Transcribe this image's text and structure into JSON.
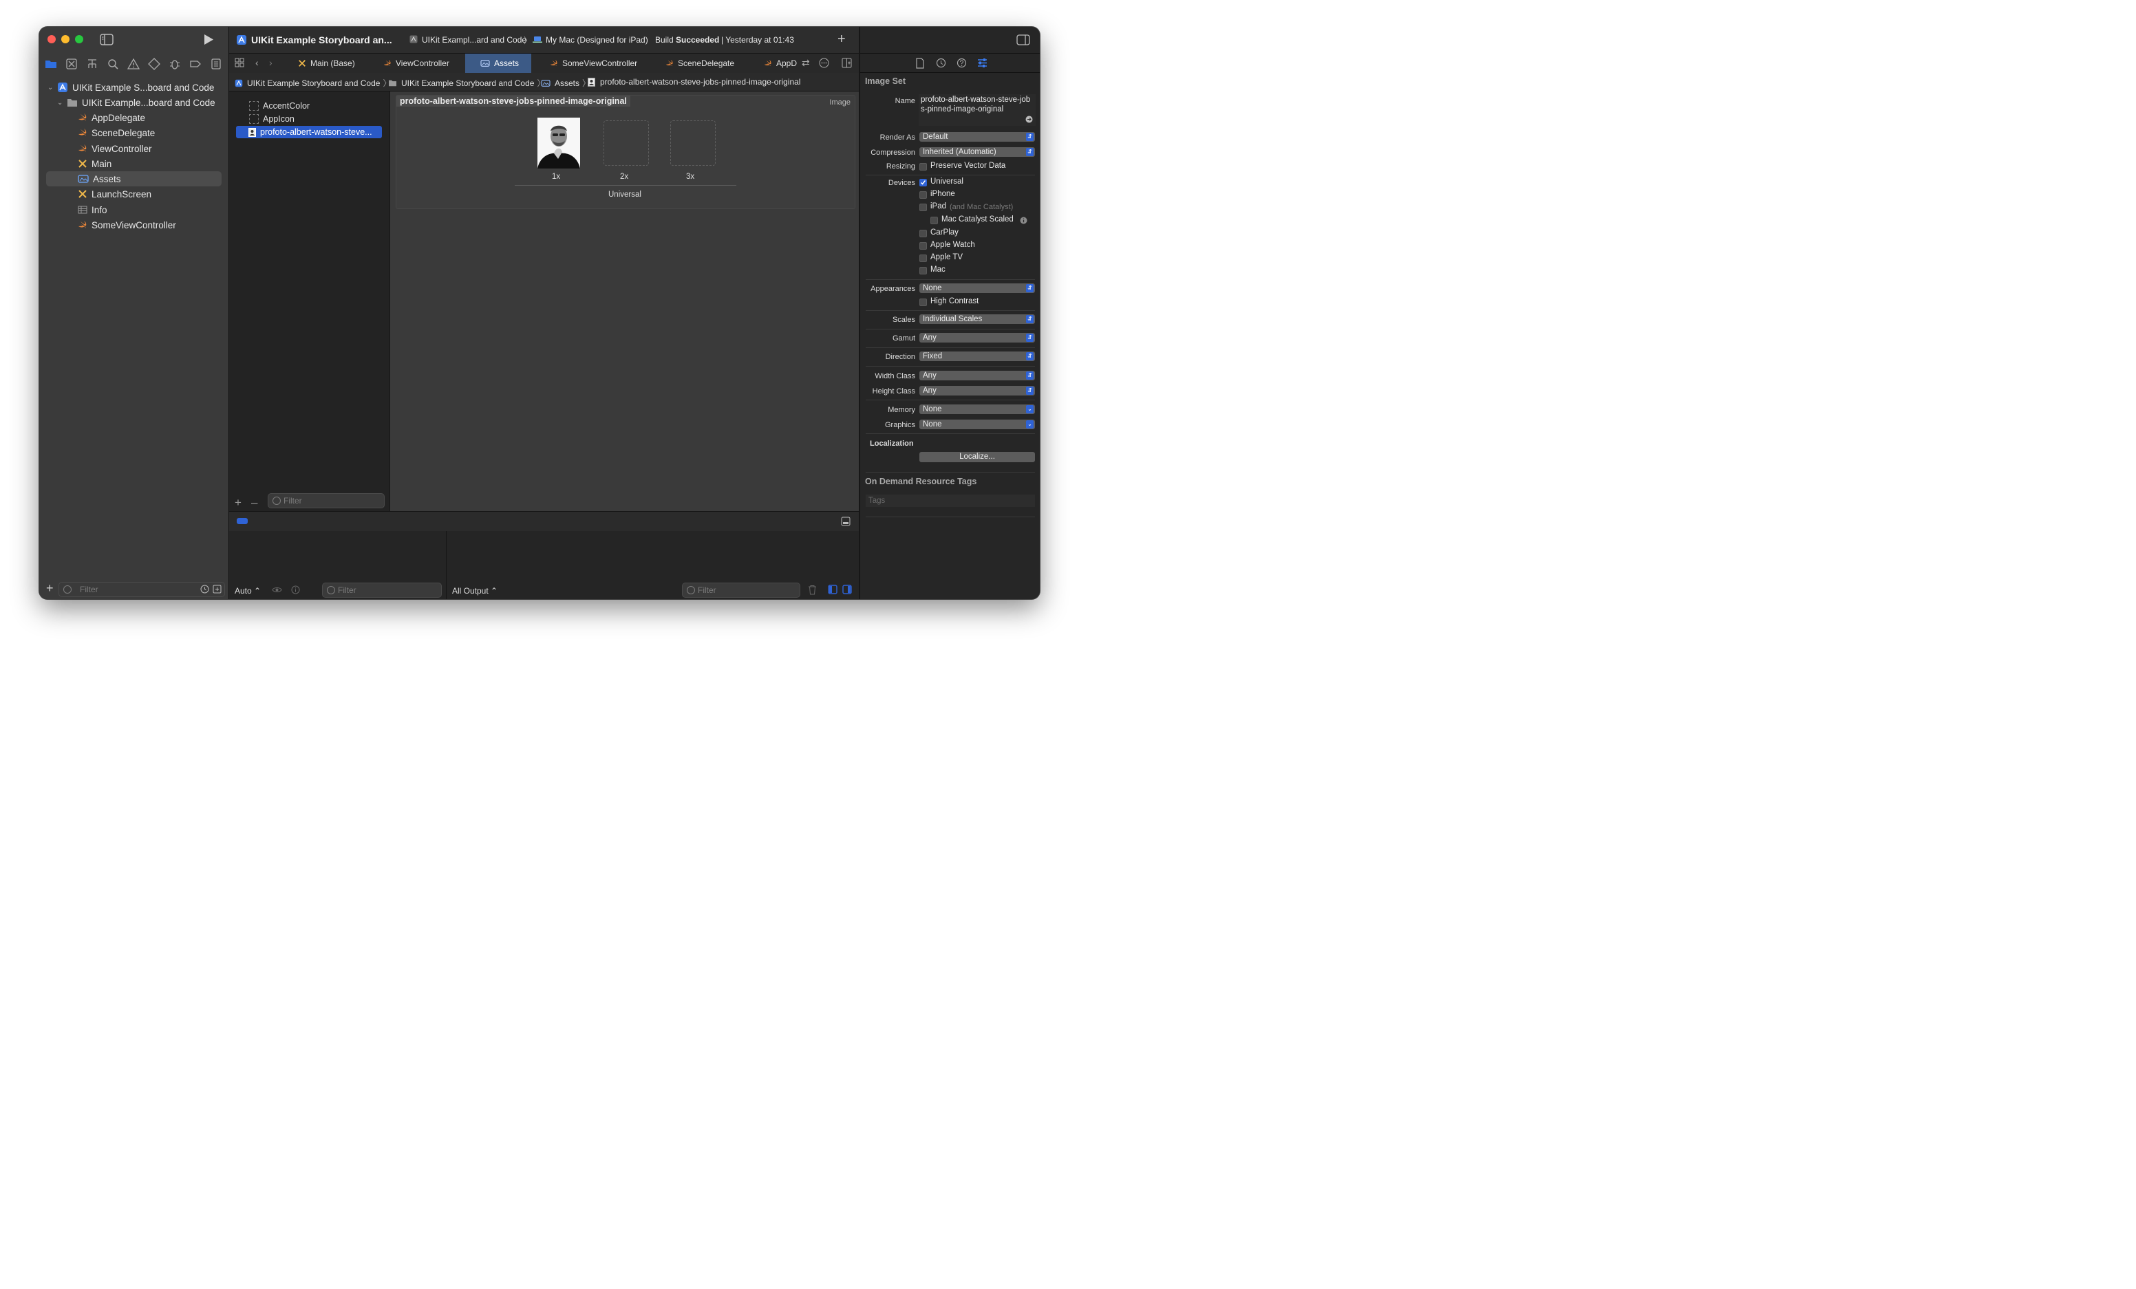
{
  "colors": {
    "accent": "#2f63d6",
    "swift_orange": "#f28a3a",
    "traffic_red": "#ff5f57",
    "traffic_yellow": "#febc2e",
    "traffic_green": "#28c840"
  },
  "titlebar": {
    "project_title": "UIKit Example Storyboard an...",
    "scheme": "UIKit Exampl...ard and Code",
    "destination": "My Mac (Designed for iPad)",
    "status_prefix": "Build",
    "status_bold": "Succeeded",
    "status_suffix": "| Yesterday at 01:43"
  },
  "navigator": {
    "tree": [
      {
        "label": "UIKit Example S...board and Code",
        "icon": "project-icon",
        "level": 0
      },
      {
        "label": "UIKit Example...board and Code",
        "icon": "folder-icon",
        "level": 1
      },
      {
        "label": "AppDelegate",
        "icon": "swift-file-icon",
        "level": 2
      },
      {
        "label": "SceneDelegate",
        "icon": "swift-file-icon",
        "level": 2
      },
      {
        "label": "ViewController",
        "icon": "swift-file-icon",
        "level": 2
      },
      {
        "label": "Main",
        "icon": "storyboard-icon",
        "level": 2
      },
      {
        "label": "Assets",
        "icon": "asset-catalog-icon",
        "level": 2,
        "selected": true
      },
      {
        "label": "LaunchScreen",
        "icon": "storyboard-icon",
        "level": 2
      },
      {
        "label": "Info",
        "icon": "plist-icon",
        "level": 2
      },
      {
        "label": "SomeViewController",
        "icon": "swift-file-icon",
        "level": 2
      }
    ],
    "filter_placeholder": "Filter"
  },
  "tabs": [
    {
      "label": "Main (Base)",
      "icon": "storyboard-icon"
    },
    {
      "label": "ViewController",
      "icon": "swift-file-icon"
    },
    {
      "label": "Assets",
      "icon": "asset-catalog-icon",
      "active": true
    },
    {
      "label": "SomeViewController",
      "icon": "swift-file-icon"
    },
    {
      "label": "SceneDelegate",
      "icon": "swift-file-icon"
    },
    {
      "label": "AppD",
      "icon": "swift-file-icon"
    }
  ],
  "jumpbar": {
    "project": "UIKit Example Storyboard and Code",
    "group": "UIKit Example Storyboard and Code",
    "catalog": "Assets",
    "asset": "profoto-albert-watson-steve-jobs-pinned-image-original"
  },
  "asset_list": {
    "items": [
      {
        "label": "AccentColor"
      },
      {
        "label": "AppIcon"
      },
      {
        "label": "profoto-albert-watson-steve...",
        "selected": true
      }
    ],
    "filter_placeholder": "Filter"
  },
  "canvas": {
    "set_name": "profoto-albert-watson-steve-jobs-pinned-image-original",
    "set_type": "Image",
    "slots": [
      "1x",
      "2x",
      "3x"
    ],
    "group_label": "Universal"
  },
  "debug": {
    "auto_label": "Auto ⌃",
    "filter_placeholder": "Filter",
    "output_label": "All Output ⌃",
    "filter2_placeholder": "Filter"
  },
  "inspector": {
    "section_title": "Image Set",
    "name_label": "Name",
    "name_value": "profoto-albert-watson-steve-jobs-pinned-image-original",
    "render_as_label": "Render As",
    "render_as": "Default",
    "compression_label": "Compression",
    "compression": "Inherited (Automatic)",
    "resizing_label": "Resizing",
    "preserve_vector": "Preserve Vector Data",
    "devices_label": "Devices",
    "devices": [
      {
        "label": "Universal",
        "checked": true
      },
      {
        "label": "iPhone",
        "checked": false
      },
      {
        "label": "iPad",
        "note": "(and Mac Catalyst)",
        "checked": false
      },
      {
        "label": "Mac Catalyst Scaled",
        "checked": false
      },
      {
        "label": "CarPlay",
        "checked": false
      },
      {
        "label": "Apple Watch",
        "checked": false
      },
      {
        "label": "Apple TV",
        "checked": false
      },
      {
        "label": "Mac",
        "checked": false
      }
    ],
    "appearances_label": "Appearances",
    "appearances": "None",
    "high_contrast": "High Contrast",
    "scales_label": "Scales",
    "scales": "Individual Scales",
    "gamut_label": "Gamut",
    "gamut": "Any",
    "direction_label": "Direction",
    "direction": "Fixed",
    "width_class_label": "Width Class",
    "width_class": "Any",
    "height_class_label": "Height Class",
    "height_class": "Any",
    "memory_label": "Memory",
    "memory": "None",
    "graphics_label": "Graphics",
    "graphics": "None",
    "localization_label": "Localization",
    "localize_button": "Localize...",
    "odr_title": "On Demand Resource Tags",
    "tags_placeholder": "Tags"
  }
}
